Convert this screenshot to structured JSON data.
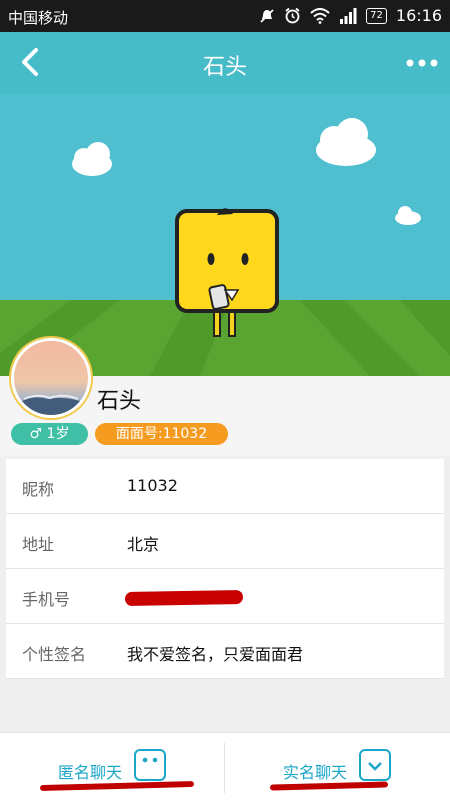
{
  "status_bar": {
    "carrier": "中国移动",
    "battery": "72",
    "time": "16:16"
  },
  "header": {
    "title": "石头"
  },
  "profile": {
    "name": "石头",
    "gender_symbol": "♂",
    "age": "1岁",
    "id_label": "面面号:11032"
  },
  "info_rows": [
    {
      "label": "昵称",
      "value": "11032"
    },
    {
      "label": "地址",
      "value": "北京"
    },
    {
      "label": "手机号",
      "value": ""
    },
    {
      "label": "个性签名",
      "value": "我不爱签名，只爱面面君"
    }
  ],
  "bottom_bar": {
    "anonymous_chat": "匿名聊天",
    "realname_chat": "实名聊天"
  },
  "colors": {
    "header": "#46bcc8",
    "sky": "#4fbfcf",
    "grass": "#5aa531",
    "gender_badge": "#3fbfa5",
    "id_badge": "#f59b1f",
    "accent": "#1aa6c8"
  }
}
